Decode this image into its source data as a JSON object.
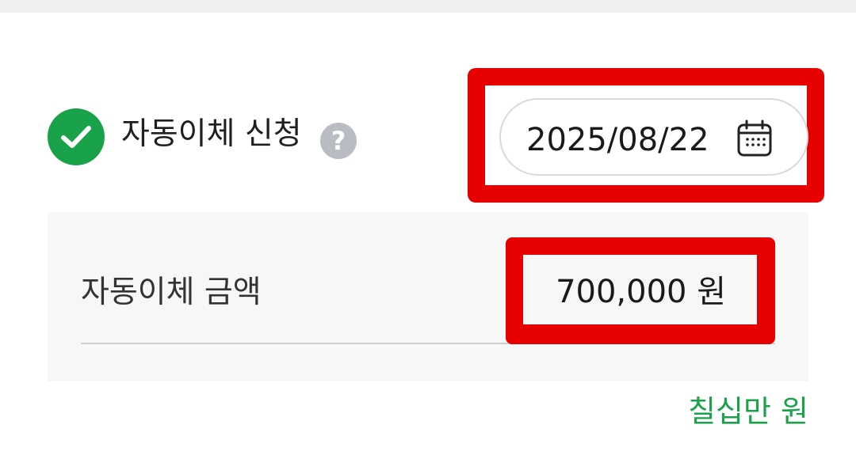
{
  "top_bar": {},
  "auto_transfer": {
    "checkbox_checked": true,
    "label": "자동이체 신청",
    "help_icon": "question-icon",
    "date_value": "2025/08/22",
    "calendar_icon": "calendar-icon"
  },
  "amount": {
    "label": "자동이체 금액",
    "value": "700,000 원",
    "korean_reading": "칠십만 원"
  },
  "colors": {
    "accent_green": "#1aa24a",
    "highlight_red": "#e60000",
    "help_gray": "#b9bcc2"
  }
}
